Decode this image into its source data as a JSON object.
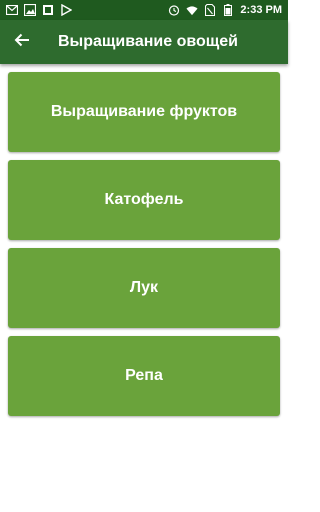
{
  "status_bar": {
    "time": "2:33 PM",
    "left_icons": [
      "gmail-icon",
      "image-icon",
      "photos-icon",
      "play-store-icon"
    ],
    "right_icons": [
      "alarm-icon",
      "wifi-icon",
      "no-sim-icon",
      "battery-icon"
    ]
  },
  "app_bar": {
    "title": "Выращивание овощей",
    "back_icon": "arrow-back-icon"
  },
  "items": [
    {
      "label": "Выращивание фруктов"
    },
    {
      "label": "Катофель"
    },
    {
      "label": "Лук"
    },
    {
      "label": "Репа"
    }
  ],
  "colors": {
    "status_bar": "#1f5a1f",
    "app_bar": "#2e6b2e",
    "card": "#6aa33b",
    "text": "#ffffff"
  }
}
